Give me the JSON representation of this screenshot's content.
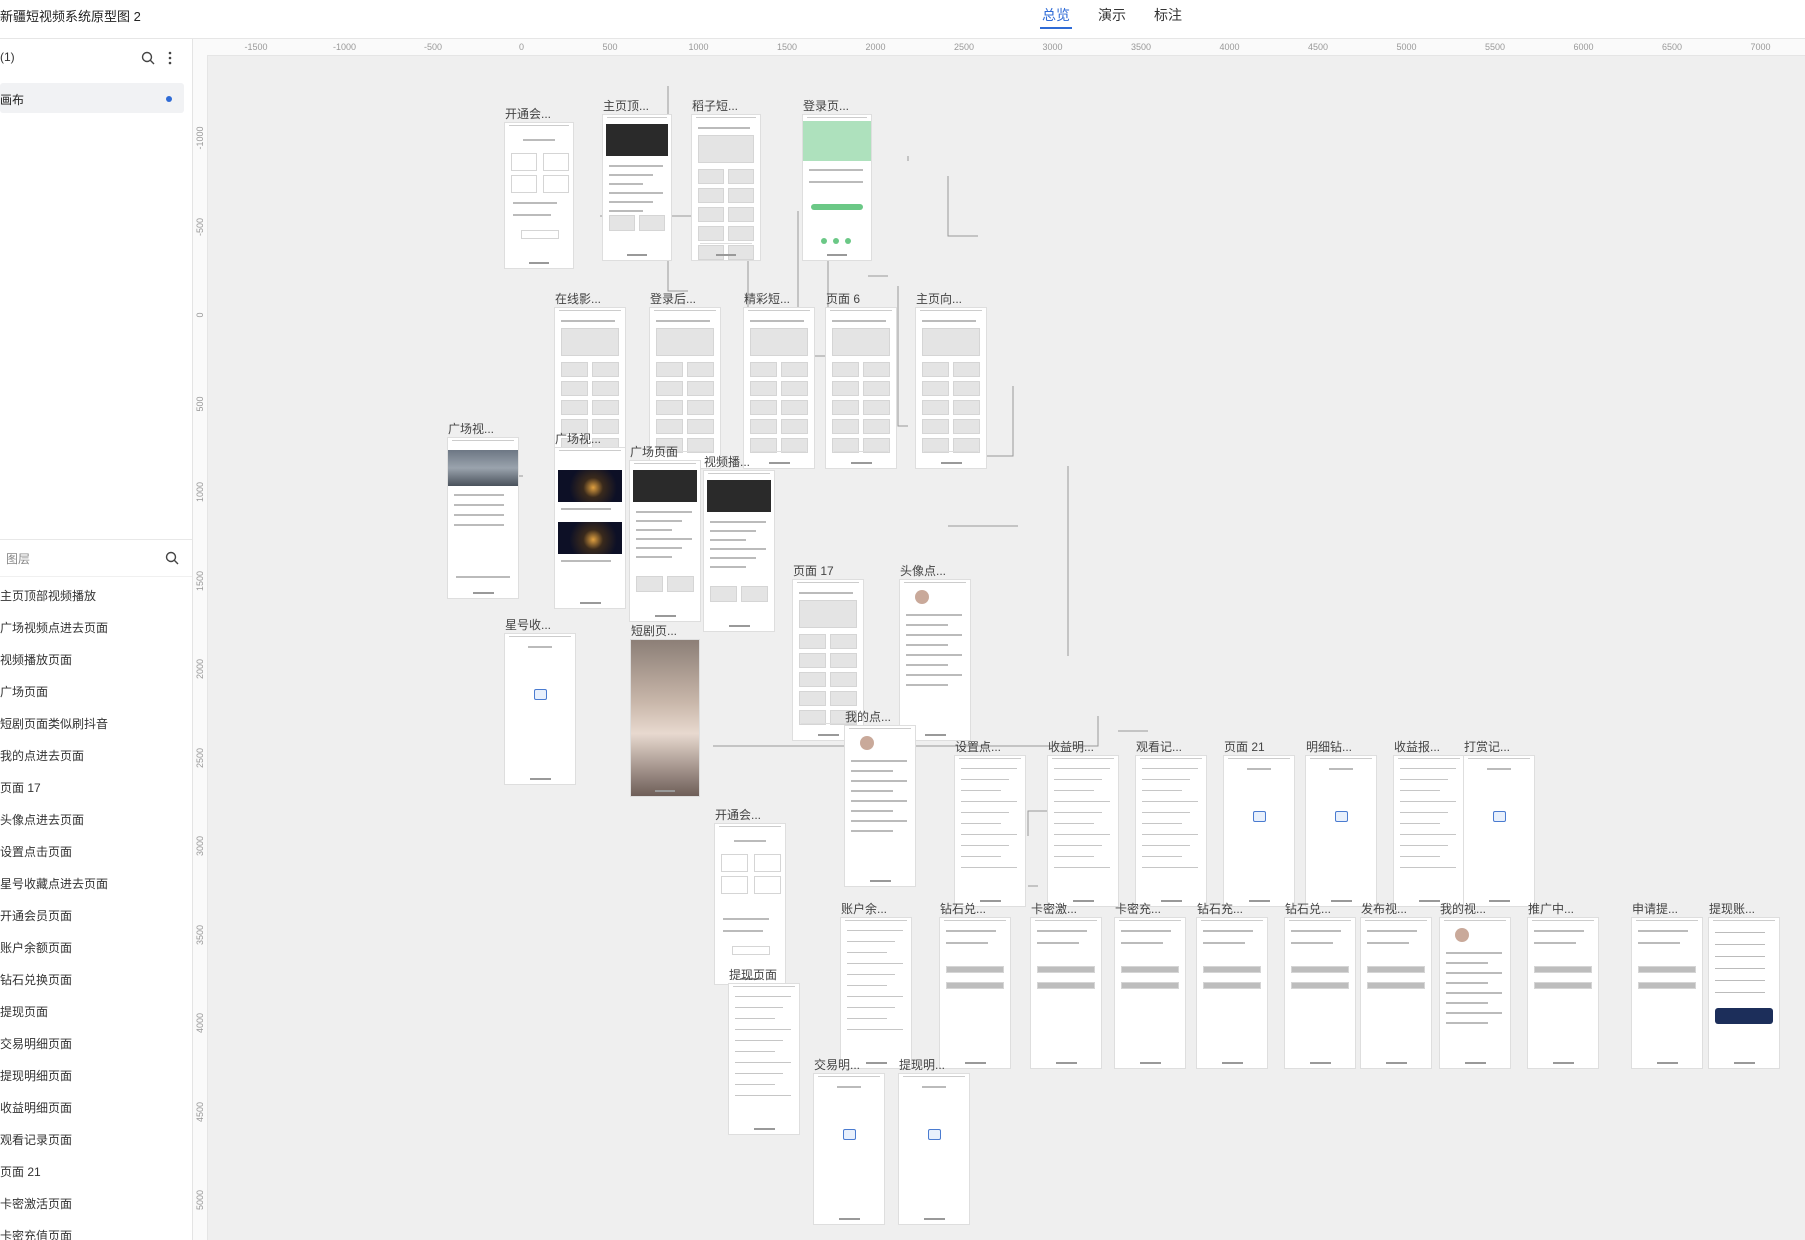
{
  "app": {
    "title": "新疆短视频系统原型图 2",
    "tabs": [
      "总览",
      "演示",
      "标注"
    ],
    "active_tab": "总览"
  },
  "sidebar": {
    "pages_label": "(1)",
    "current_page": "画布",
    "layers_search_placeholder": "图层",
    "layers": [
      "主页顶部视频播放",
      "广场视频点进去页面",
      "视频播放页面",
      "广场页面",
      "短剧页面类似刷抖音",
      "我的点进去页面",
      "页面 17",
      "头像点进去页面",
      "设置点击页面",
      "星号收藏点进去页面",
      "开通会员页面",
      "账户余额页面",
      "钻石兑换页面",
      "提现页面",
      "交易明细页面",
      "提现明细页面",
      "收益明细页面",
      "观看记录页面",
      "页面 21",
      "卡密激活页面",
      "卡密充值页面"
    ]
  },
  "rulers": {
    "horizontal": [
      "-1500",
      "-1000",
      "-500",
      "0",
      "500",
      "1000",
      "1500",
      "2000",
      "2500",
      "3000",
      "3500",
      "4000",
      "4500",
      "5000",
      "5500",
      "6000",
      "6500",
      "7000"
    ],
    "vertical": [
      "-1000",
      "-500",
      "0",
      "500",
      "1000",
      "1500",
      "2000",
      "2500",
      "3000",
      "3500",
      "4000",
      "4500",
      "5000"
    ]
  },
  "artboards": [
    {
      "label": "开通会...",
      "kind": "vip"
    },
    {
      "label": "主页顶...",
      "kind": "video"
    },
    {
      "label": "稻子短...",
      "kind": "grid"
    },
    {
      "label": "登录页...",
      "kind": "login"
    },
    {
      "label": "在线影...",
      "kind": "grid"
    },
    {
      "label": "登录后...",
      "kind": "grid"
    },
    {
      "label": "精彩短...",
      "kind": "grid"
    },
    {
      "label": "页面 6",
      "kind": "grid"
    },
    {
      "label": "主页向...",
      "kind": "grid"
    },
    {
      "label": "广场视...",
      "kind": "car"
    },
    {
      "label": "广场视...",
      "kind": "night"
    },
    {
      "label": "广场页面",
      "kind": "video"
    },
    {
      "label": "视频播...",
      "kind": "video"
    },
    {
      "label": "页面 17",
      "kind": "grid"
    },
    {
      "label": "头像点...",
      "kind": "profile"
    },
    {
      "label": "星号收...",
      "kind": "empty"
    },
    {
      "label": "短剧页...",
      "kind": "photo"
    },
    {
      "label": "我的点...",
      "kind": "profile"
    },
    {
      "label": "设置点...",
      "kind": "list"
    },
    {
      "label": "收益明...",
      "kind": "list"
    },
    {
      "label": "观看记...",
      "kind": "list"
    },
    {
      "label": "页面 21",
      "kind": "empty"
    },
    {
      "label": "明细钻...",
      "kind": "empty"
    },
    {
      "label": "收益报...",
      "kind": "list"
    },
    {
      "label": "打赏记...",
      "kind": "empty"
    },
    {
      "label": "开通会...",
      "kind": "vip"
    },
    {
      "label": "账户余...",
      "kind": "list"
    },
    {
      "label": "钻石兑...",
      "kind": "form"
    },
    {
      "label": "卡密激...",
      "kind": "form"
    },
    {
      "label": "卡密充...",
      "kind": "form"
    },
    {
      "label": "钻石充...",
      "kind": "form"
    },
    {
      "label": "钻石兑...",
      "kind": "form"
    },
    {
      "label": "发布视...",
      "kind": "form"
    },
    {
      "label": "我的视...",
      "kind": "profile"
    },
    {
      "label": "推广中...",
      "kind": "form"
    },
    {
      "label": "申请提...",
      "kind": "form"
    },
    {
      "label": "提现账...",
      "kind": "navy"
    },
    {
      "label": "提现页面",
      "kind": "list"
    },
    {
      "label": "交易明...",
      "kind": "empty"
    },
    {
      "label": "提现明...",
      "kind": "empty"
    }
  ],
  "colors": {
    "accent": "#2f6bd6",
    "canvas": "#efefef",
    "login_green": "#6bc886",
    "navy": "#1c2e5a"
  }
}
